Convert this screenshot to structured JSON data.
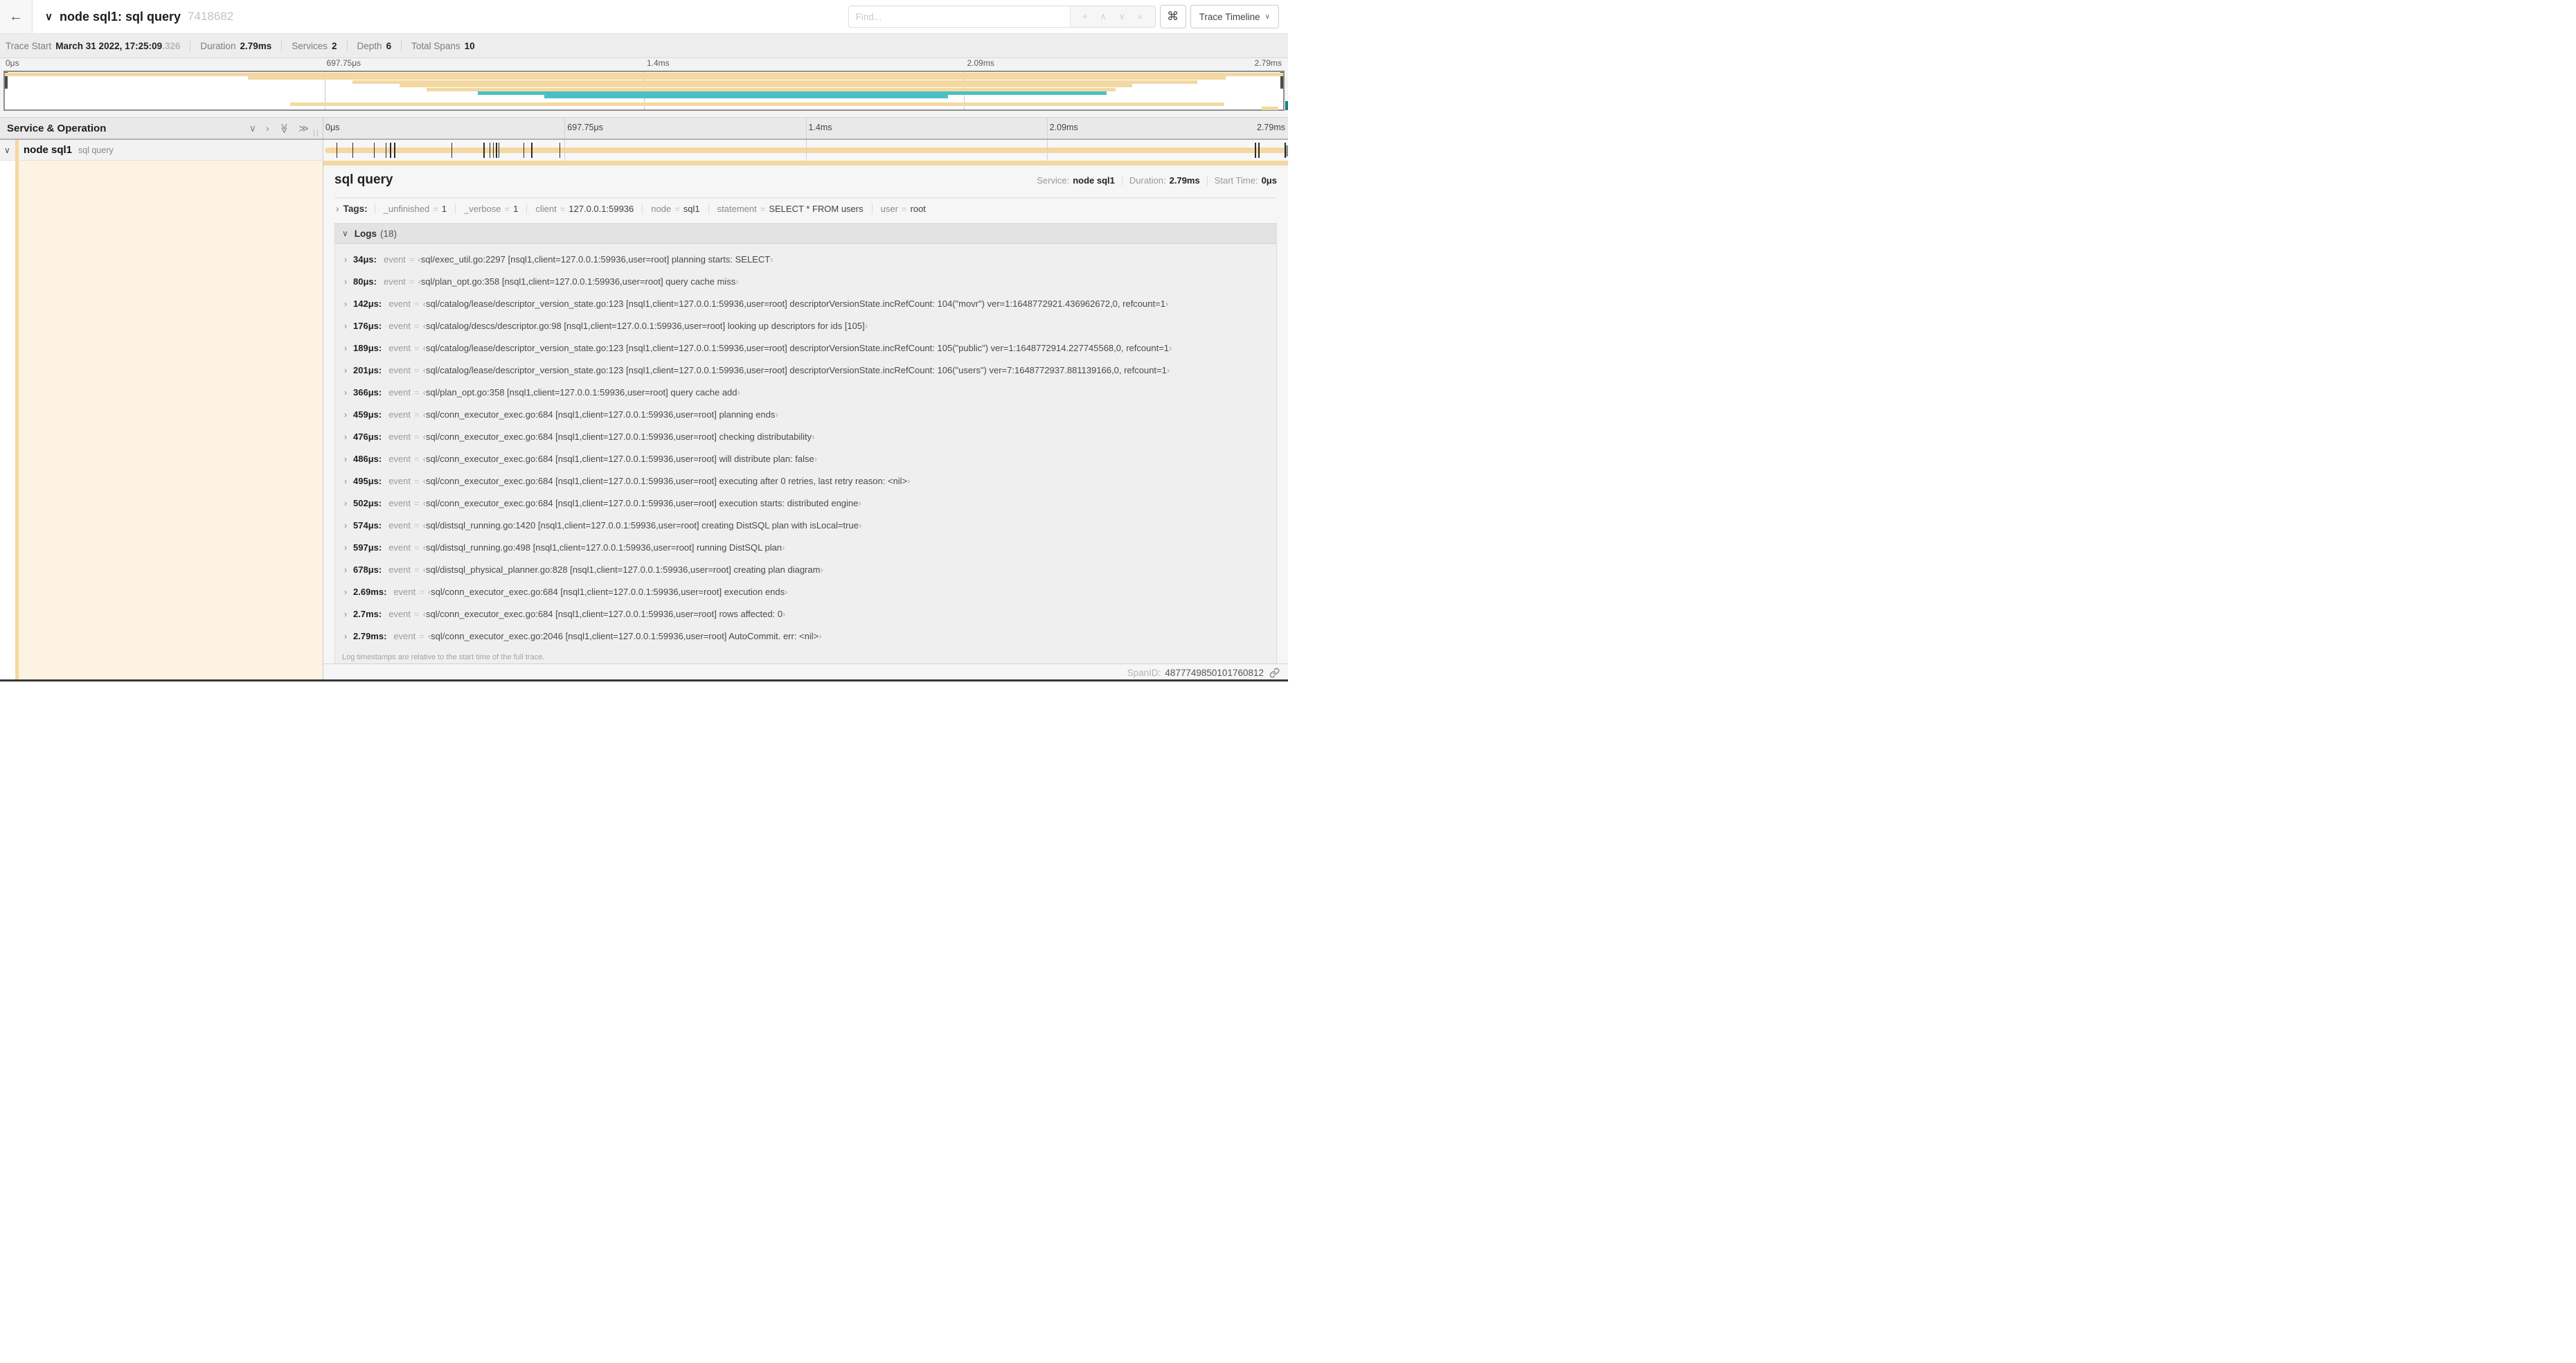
{
  "header": {
    "back_icon": "←",
    "collapse_icon": "∨",
    "title": "node sql1: sql query",
    "trace_id": "7418682",
    "find_placeholder": "Find...",
    "find_icons": {
      "locate": "⌖",
      "prev": "∧",
      "next": "∨",
      "clear": "×"
    },
    "shortcut_icon": "⌘",
    "view_button": {
      "label": "Trace Timeline",
      "caret": "∨"
    }
  },
  "meta": {
    "items": [
      {
        "label": "Trace Start",
        "value": "March 31 2022, 17:25:09",
        "muted": ".326"
      },
      {
        "label": "Duration",
        "value": "2.79ms"
      },
      {
        "label": "Services",
        "value": "2"
      },
      {
        "label": "Depth",
        "value": "6"
      },
      {
        "label": "Total Spans",
        "value": "10"
      }
    ]
  },
  "timeline": {
    "left_header": "Service & Operation",
    "collapse_icons": [
      "∨",
      "›",
      "≫",
      "≫"
    ],
    "tick_labels": [
      "0μs",
      "697.75μs",
      "1.4ms",
      "2.09ms",
      "2.79ms"
    ],
    "tick_positions": [
      0,
      25,
      50,
      75,
      100
    ],
    "total_us": 2790,
    "log_marks_us": [
      34,
      80,
      142,
      176,
      189,
      201,
      366,
      459,
      476,
      486,
      495,
      502,
      574,
      597,
      678,
      2690,
      2700,
      2790
    ]
  },
  "minimap": {
    "rows": [
      {
        "slot": 0,
        "start": 0,
        "end": 100,
        "color": "tan"
      },
      {
        "slot": 1,
        "start": 19.0,
        "end": 95.5,
        "color": "tan"
      },
      {
        "slot": 2,
        "start": 27.2,
        "end": 93.3,
        "color": "tan"
      },
      {
        "slot": 3,
        "start": 30.9,
        "end": 88.2,
        "color": "tan"
      },
      {
        "slot": 4,
        "start": 33.0,
        "end": 86.9,
        "color": "tan"
      },
      {
        "slot": 5,
        "start": 37.0,
        "end": 86.2,
        "color": "teal"
      },
      {
        "slot": 6,
        "start": 42.2,
        "end": 73.8,
        "color": "teal"
      },
      {
        "slot": 8,
        "start": 22.3,
        "end": 95.4,
        "color": "tan"
      },
      {
        "slot": 9,
        "start": 98.3,
        "end": 99.6,
        "color": "tan"
      }
    ]
  },
  "span_row": {
    "expander": "∨",
    "service": "node sql1",
    "operation": "sql query"
  },
  "detail": {
    "title": "sql query",
    "stats": [
      {
        "label": "Service:",
        "value": "node sql1"
      },
      {
        "label": "Duration:",
        "value": "2.79ms"
      },
      {
        "label": "Start Time:",
        "value": "0μs"
      }
    ],
    "tags_label": "Tags:",
    "tags": [
      {
        "key": "_unfinished",
        "value": "1"
      },
      {
        "key": "_verbose",
        "value": "1"
      },
      {
        "key": "client",
        "value": "127.0.0.1:59936"
      },
      {
        "key": "node",
        "value": "sql1"
      },
      {
        "key": "statement",
        "value": "SELECT * FROM users"
      },
      {
        "key": "user",
        "value": "root"
      }
    ],
    "logs_label": "Logs",
    "logs_count": "(18)",
    "logs": [
      {
        "time": "34μs",
        "field": "event",
        "value": "sql/exec_util.go:2297 [nsql1,client=127.0.0.1:59936,user=root] planning starts: SELECT"
      },
      {
        "time": "80μs",
        "field": "event",
        "value": "sql/plan_opt.go:358 [nsql1,client=127.0.0.1:59936,user=root] query cache miss"
      },
      {
        "time": "142μs",
        "field": "event",
        "value": "sql/catalog/lease/descriptor_version_state.go:123 [nsql1,client=127.0.0.1:59936,user=root] descriptorVersionState.incRefCount: 104(\"movr\") ver=1:1648772921.436962672,0, refcount=1"
      },
      {
        "time": "176μs",
        "field": "event",
        "value": "sql/catalog/descs/descriptor.go:98 [nsql1,client=127.0.0.1:59936,user=root] looking up descriptors for ids [105]"
      },
      {
        "time": "189μs",
        "field": "event",
        "value": "sql/catalog/lease/descriptor_version_state.go:123 [nsql1,client=127.0.0.1:59936,user=root] descriptorVersionState.incRefCount: 105(\"public\") ver=1:1648772914.227745568,0, refcount=1"
      },
      {
        "time": "201μs",
        "field": "event",
        "value": "sql/catalog/lease/descriptor_version_state.go:123 [nsql1,client=127.0.0.1:59936,user=root] descriptorVersionState.incRefCount: 106(\"users\") ver=7:1648772937.881139166,0, refcount=1"
      },
      {
        "time": "366μs",
        "field": "event",
        "value": "sql/plan_opt.go:358 [nsql1,client=127.0.0.1:59936,user=root] query cache add"
      },
      {
        "time": "459μs",
        "field": "event",
        "value": "sql/conn_executor_exec.go:684 [nsql1,client=127.0.0.1:59936,user=root] planning ends"
      },
      {
        "time": "476μs",
        "field": "event",
        "value": "sql/conn_executor_exec.go:684 [nsql1,client=127.0.0.1:59936,user=root] checking distributability"
      },
      {
        "time": "486μs",
        "field": "event",
        "value": "sql/conn_executor_exec.go:684 [nsql1,client=127.0.0.1:59936,user=root] will distribute plan: false"
      },
      {
        "time": "495μs",
        "field": "event",
        "value": "sql/conn_executor_exec.go:684 [nsql1,client=127.0.0.1:59936,user=root] executing after 0 retries, last retry reason: <nil>"
      },
      {
        "time": "502μs",
        "field": "event",
        "value": "sql/conn_executor_exec.go:684 [nsql1,client=127.0.0.1:59936,user=root] execution starts: distributed engine"
      },
      {
        "time": "574μs",
        "field": "event",
        "value": "sql/distsql_running.go:1420 [nsql1,client=127.0.0.1:59936,user=root] creating DistSQL plan with isLocal=true"
      },
      {
        "time": "597μs",
        "field": "event",
        "value": "sql/distsql_running.go:498 [nsql1,client=127.0.0.1:59936,user=root] running DistSQL plan"
      },
      {
        "time": "678μs",
        "field": "event",
        "value": "sql/distsql_physical_planner.go:828 [nsql1,client=127.0.0.1:59936,user=root] creating plan diagram"
      },
      {
        "time": "2.69ms",
        "field": "event",
        "value": "sql/conn_executor_exec.go:684 [nsql1,client=127.0.0.1:59936,user=root] execution ends"
      },
      {
        "time": "2.7ms",
        "field": "event",
        "value": "sql/conn_executor_exec.go:684 [nsql1,client=127.0.0.1:59936,user=root] rows affected: 0"
      },
      {
        "time": "2.79ms",
        "field": "event",
        "value": "sql/conn_executor_exec.go:2046 [nsql1,client=127.0.0.1:59936,user=root] AutoCommit. err: <nil>"
      }
    ],
    "footer_note": "Log timestamps are relative to the start time of the full trace.",
    "span_id_label": "SpanID:",
    "span_id": "4877749850101760812"
  },
  "icons": {
    "chevron_right": "›",
    "chevron_down": "∨"
  },
  "colors": {
    "tan": "#f3d8a2",
    "teal": "#49c0c2",
    "accent": "#f5d99c",
    "cream": "#fdf3e2",
    "scrollteal": "#0d7f85"
  }
}
